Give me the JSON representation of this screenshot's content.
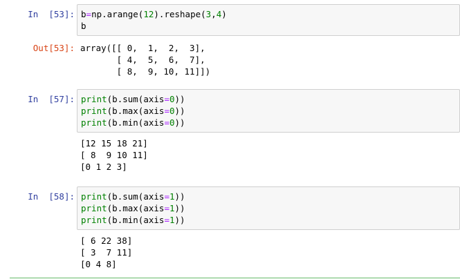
{
  "cells": [
    {
      "in_prompt": "In  [53]:",
      "input_lines": [
        [
          {
            "t": "b",
            "c": "var"
          },
          {
            "t": "=",
            "c": "op"
          },
          {
            "t": "np.arange(",
            "c": "var"
          },
          {
            "t": "12",
            "c": "num"
          },
          {
            "t": ").reshape(",
            "c": "var"
          },
          {
            "t": "3",
            "c": "num"
          },
          {
            "t": ",",
            "c": "var"
          },
          {
            "t": "4",
            "c": "num"
          },
          {
            "t": ")",
            "c": "var"
          }
        ],
        [
          {
            "t": "b",
            "c": "var"
          }
        ]
      ],
      "out_prompt": "Out[53]:",
      "output_lines": [
        "array([[ 0,  1,  2,  3],",
        "       [ 4,  5,  6,  7],",
        "       [ 8,  9, 10, 11]])"
      ]
    },
    {
      "in_prompt": "In  [57]:",
      "input_lines": [
        [
          {
            "t": "print",
            "c": "kw"
          },
          {
            "t": "(b.sum(axis",
            "c": "var"
          },
          {
            "t": "=",
            "c": "op"
          },
          {
            "t": "0",
            "c": "num"
          },
          {
            "t": "))",
            "c": "var"
          }
        ],
        [
          {
            "t": "print",
            "c": "kw"
          },
          {
            "t": "(b.max(axis",
            "c": "var"
          },
          {
            "t": "=",
            "c": "op"
          },
          {
            "t": "0",
            "c": "num"
          },
          {
            "t": "))",
            "c": "var"
          }
        ],
        [
          {
            "t": "print",
            "c": "kw"
          },
          {
            "t": "(b.min(axis",
            "c": "var"
          },
          {
            "t": "=",
            "c": "op"
          },
          {
            "t": "0",
            "c": "num"
          },
          {
            "t": "))",
            "c": "var"
          }
        ]
      ],
      "out_prompt": "",
      "output_lines": [
        "[12 15 18 21]",
        "[ 8  9 10 11]",
        "[0 1 2 3]"
      ]
    },
    {
      "in_prompt": "In  [58]:",
      "input_lines": [
        [
          {
            "t": "print",
            "c": "kw"
          },
          {
            "t": "(b.sum(axis",
            "c": "var"
          },
          {
            "t": "=",
            "c": "op"
          },
          {
            "t": "1",
            "c": "num"
          },
          {
            "t": "))",
            "c": "var"
          }
        ],
        [
          {
            "t": "print",
            "c": "kw"
          },
          {
            "t": "(b.max(axis",
            "c": "var"
          },
          {
            "t": "=",
            "c": "op"
          },
          {
            "t": "1",
            "c": "num"
          },
          {
            "t": "))",
            "c": "var"
          }
        ],
        [
          {
            "t": "print",
            "c": "kw"
          },
          {
            "t": "(b.min(axis",
            "c": "var"
          },
          {
            "t": "=",
            "c": "op"
          },
          {
            "t": "1",
            "c": "num"
          },
          {
            "t": "))",
            "c": "var"
          }
        ]
      ],
      "out_prompt": "",
      "output_lines": [
        "[ 6 22 38]",
        "[ 3  7 11]",
        "[0 4 8]"
      ]
    }
  ]
}
